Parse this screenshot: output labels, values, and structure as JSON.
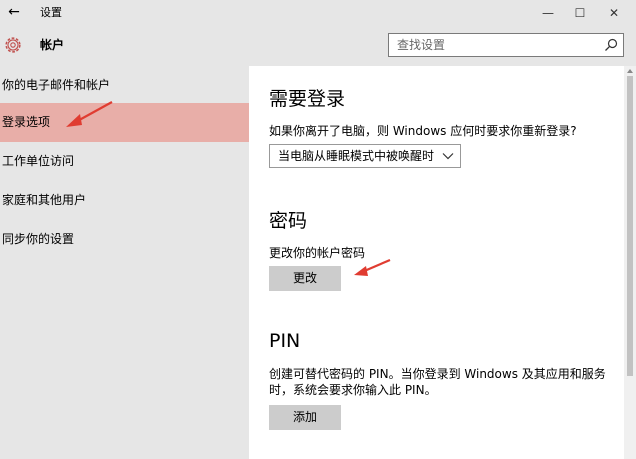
{
  "window": {
    "title": "设置",
    "back_glyph": "←",
    "minimize_glyph": "—",
    "maximize_glyph": "☐",
    "close_glyph": "✕"
  },
  "header": {
    "section_title": "帐户",
    "icon": "gear-icon",
    "search_placeholder": "查找设置"
  },
  "sidebar": {
    "items": [
      {
        "label": "你的电子邮件和帐户"
      },
      {
        "label": "登录选项",
        "active": true
      },
      {
        "label": "工作单位访问"
      },
      {
        "label": "家庭和其他用户"
      },
      {
        "label": "同步你的设置"
      }
    ]
  },
  "main": {
    "require_signin": {
      "title": "需要登录",
      "question": "如果你离开了电脑，则 Windows 应何时要求你重新登录?",
      "selected_option": "当电脑从睡眠模式中被唤醒时"
    },
    "password": {
      "title": "密码",
      "label": "更改你的帐户密码",
      "button": "更改"
    },
    "pin": {
      "title": "PIN",
      "description_line1": "创建可替代密码的 PIN。当你登录到 Windows 及其应用和服务",
      "description_line2": "时，系统会要求你输入此 PIN。",
      "button": "添加"
    }
  },
  "colors": {
    "chrome": "#e6e6e6",
    "active_item": "#e8aea8",
    "accent_icon": "#c0504d",
    "annotation_arrow": "#e03c31",
    "button": "#cccccc"
  }
}
